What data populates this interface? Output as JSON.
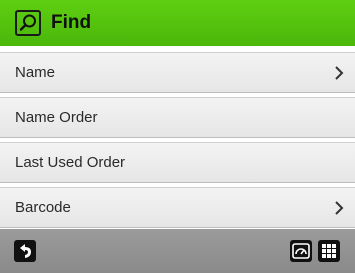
{
  "header": {
    "title": "Find",
    "icon": "search-icon",
    "accent_color": "#52c40d"
  },
  "menu": {
    "items": [
      {
        "label": "Name",
        "has_submenu": true
      },
      {
        "label": "Name Order",
        "has_submenu": false
      },
      {
        "label": "Last Used Order",
        "has_submenu": false
      },
      {
        "label": "Barcode",
        "has_submenu": true
      }
    ]
  },
  "footer": {
    "back_icon": "back-arrow-icon",
    "right_icons": [
      "dashboard-gauge-icon",
      "grid-icon"
    ]
  }
}
